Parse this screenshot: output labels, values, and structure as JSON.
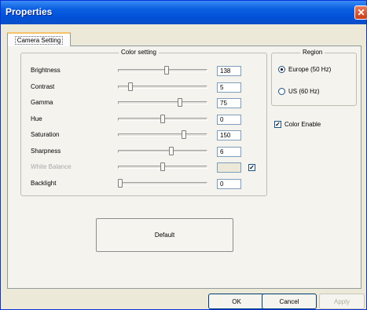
{
  "window": {
    "title": "Properties",
    "close_glyph": "✕"
  },
  "tabs": [
    "Camera Setting"
  ],
  "color_group": {
    "title": "Color setting",
    "sliders": [
      {
        "label": "Brightness",
        "value": "138",
        "fraction": 0.55,
        "disabled": false
      },
      {
        "label": "Contrast",
        "value": "5",
        "fraction": 0.12,
        "disabled": false
      },
      {
        "label": "Gamma",
        "value": "75",
        "fraction": 0.7,
        "disabled": false
      },
      {
        "label": "Hue",
        "value": "0",
        "fraction": 0.5,
        "disabled": false
      },
      {
        "label": "Saturation",
        "value": "150",
        "fraction": 0.75,
        "disabled": false
      },
      {
        "label": "Sharpness",
        "value": "6",
        "fraction": 0.6,
        "disabled": false
      },
      {
        "label": "White Balance",
        "value": "",
        "fraction": 0.5,
        "disabled": true,
        "auto_checked": true
      },
      {
        "label": "Backlight",
        "value": "0",
        "fraction": 0.0,
        "disabled": false
      }
    ]
  },
  "region": {
    "title": "Region",
    "options": [
      {
        "label": "Europe (50 Hz)",
        "selected": true
      },
      {
        "label": "US (60 Hz)",
        "selected": false
      }
    ]
  },
  "color_enable": {
    "label": "Color Enable",
    "checked": true
  },
  "default_button": "Default",
  "footer": {
    "ok": "OK",
    "cancel": "Cancel",
    "apply": "Apply"
  },
  "check_glyph": "✓"
}
